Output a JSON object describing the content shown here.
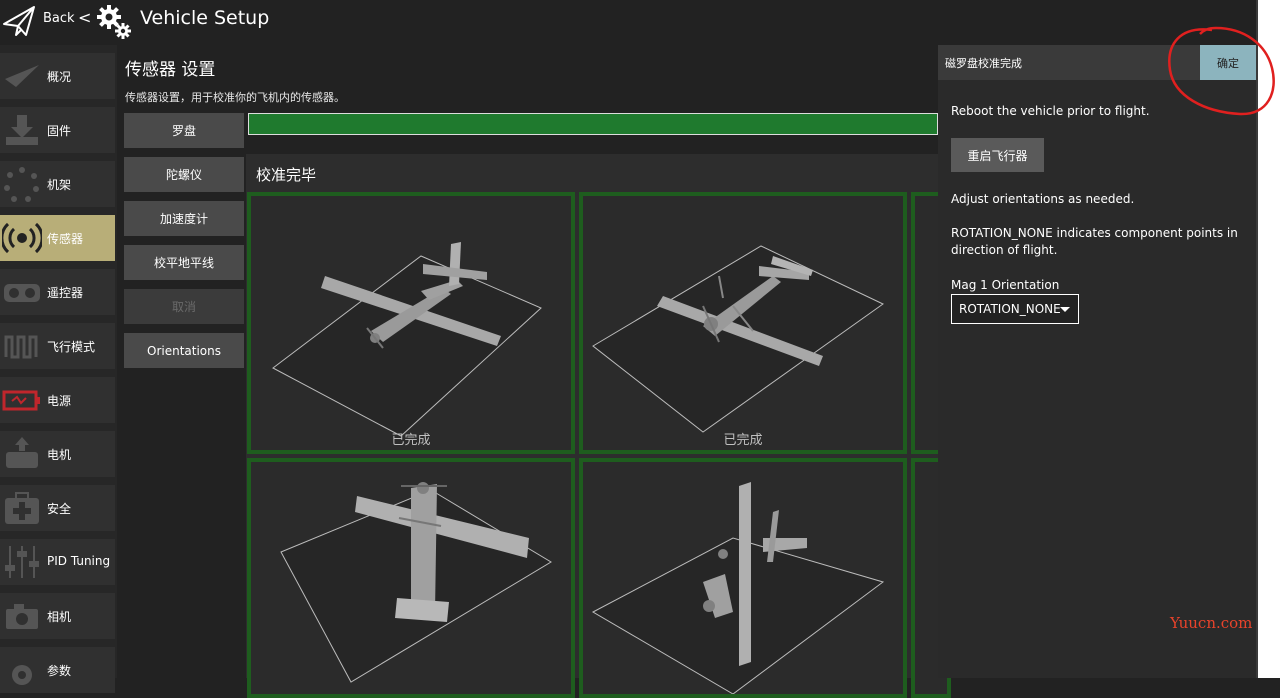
{
  "header": {
    "back_label": "Back",
    "chevron": "<",
    "title": "Vehicle Setup"
  },
  "sidebar": {
    "items": [
      {
        "label": "概况",
        "icon": "paper-plane-icon",
        "active": false
      },
      {
        "label": "固件",
        "icon": "download-icon",
        "active": false
      },
      {
        "label": "机架",
        "icon": "frame-icon",
        "active": false
      },
      {
        "label": "传感器",
        "icon": "sensor-icon",
        "active": true
      },
      {
        "label": "遥控器",
        "icon": "radio-icon",
        "active": false
      },
      {
        "label": "飞行模式",
        "icon": "flight-modes-icon",
        "active": false
      },
      {
        "label": "电源",
        "icon": "battery-icon",
        "active": false
      },
      {
        "label": "电机",
        "icon": "motor-icon",
        "active": false
      },
      {
        "label": "安全",
        "icon": "safety-icon",
        "active": false
      },
      {
        "label": "PID Tuning",
        "icon": "sliders-icon",
        "active": false
      },
      {
        "label": "相机",
        "icon": "camera-icon",
        "active": false
      },
      {
        "label": "参数",
        "icon": "gear-icon",
        "active": false
      }
    ]
  },
  "main": {
    "title": "传感器 设置",
    "description": "传感器设置，用于校准你的飞机内的传感器。",
    "buttons": [
      {
        "label": "罗盘",
        "disabled": false
      },
      {
        "label": "陀螺仪",
        "disabled": false
      },
      {
        "label": "加速度计",
        "disabled": false
      },
      {
        "label": "校平地平线",
        "disabled": false
      },
      {
        "label": "取消",
        "disabled": true
      },
      {
        "label": "Orientations",
        "disabled": false
      }
    ],
    "progress": 1.0,
    "status_title": "校准完毕",
    "tiles": [
      {
        "caption": "已完成"
      },
      {
        "caption": "已完成"
      },
      {
        "caption": ""
      },
      {
        "caption": ""
      }
    ]
  },
  "right_panel": {
    "title": "磁罗盘校准完成",
    "ok_label": "确定",
    "reboot_text": "Reboot the vehicle prior to flight.",
    "reboot_button": "重启飞行器",
    "adjust_text": "Adjust orientations as needed.",
    "rotation_text": "ROTATION_NONE indicates component points in direction of flight.",
    "mag_label": "Mag 1 Orientation",
    "mag_value": "ROTATION_NONE"
  },
  "watermark": "Yuucn.com",
  "colors": {
    "accent_active": "#b8ae78",
    "progress_green": "#1f7a2e",
    "ok_button": "#8cb4be",
    "annotation_red": "#e0201f"
  }
}
